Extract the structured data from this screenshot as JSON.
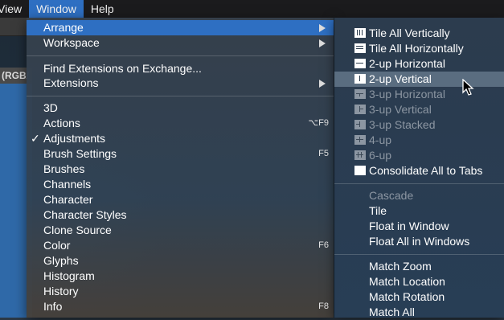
{
  "menubar": {
    "items": [
      {
        "label": "View"
      },
      {
        "label": "Window"
      },
      {
        "label": "Help"
      }
    ]
  },
  "background": {
    "tab_text": "(RGB/"
  },
  "window_menu": {
    "top": [
      {
        "label": "Arrange",
        "submenu": true
      },
      {
        "label": "Workspace",
        "submenu": true
      }
    ],
    "middle": [
      {
        "label": "Find Extensions on Exchange..."
      },
      {
        "label": "Extensions",
        "submenu": true
      }
    ],
    "panels": [
      {
        "label": "3D",
        "shortcut": "",
        "checked": false
      },
      {
        "label": "Actions",
        "shortcut": "⌥F9",
        "checked": false
      },
      {
        "label": "Adjustments",
        "shortcut": "",
        "checked": true
      },
      {
        "label": "Brush Settings",
        "shortcut": "F5",
        "checked": false
      },
      {
        "label": "Brushes",
        "shortcut": "",
        "checked": false
      },
      {
        "label": "Channels",
        "shortcut": "",
        "checked": false
      },
      {
        "label": "Character",
        "shortcut": "",
        "checked": false
      },
      {
        "label": "Character Styles",
        "shortcut": "",
        "checked": false
      },
      {
        "label": "Clone Source",
        "shortcut": "",
        "checked": false
      },
      {
        "label": "Color",
        "shortcut": "F6",
        "checked": false
      },
      {
        "label": "Glyphs",
        "shortcut": "",
        "checked": false
      },
      {
        "label": "Histogram",
        "shortcut": "",
        "checked": false
      },
      {
        "label": "History",
        "shortcut": "",
        "checked": false
      },
      {
        "label": "Info",
        "shortcut": "F8",
        "checked": false
      }
    ],
    "check_mark": "✓"
  },
  "arrange_submenu": {
    "layouts": [
      {
        "label": "Tile All Vertically",
        "icon": "tile-vertical-icon",
        "enabled": true
      },
      {
        "label": "Tile All Horizontally",
        "icon": "tile-horizontal-icon",
        "enabled": true
      },
      {
        "label": "2-up Horizontal",
        "icon": "two-up-horizontal-icon",
        "enabled": true
      },
      {
        "label": "2-up Vertical",
        "icon": "two-up-vertical-icon",
        "enabled": true,
        "highlighted": true
      },
      {
        "label": "3-up Horizontal",
        "icon": "three-up-horizontal-icon",
        "enabled": false
      },
      {
        "label": "3-up Vertical",
        "icon": "three-up-vertical-icon",
        "enabled": false
      },
      {
        "label": "3-up Stacked",
        "icon": "three-up-stacked-icon",
        "enabled": false
      },
      {
        "label": "4-up",
        "icon": "four-up-icon",
        "enabled": false
      },
      {
        "label": "6-up",
        "icon": "six-up-icon",
        "enabled": false
      },
      {
        "label": "Consolidate All to Tabs",
        "icon": "consolidate-tabs-icon",
        "enabled": true
      }
    ],
    "float": [
      {
        "label": "Cascade",
        "enabled": false
      },
      {
        "label": "Tile",
        "enabled": true
      },
      {
        "label": "Float in Window",
        "enabled": true
      },
      {
        "label": "Float All in Windows",
        "enabled": true
      }
    ],
    "match": [
      {
        "label": "Match Zoom",
        "enabled": true
      },
      {
        "label": "Match Location",
        "enabled": true
      },
      {
        "label": "Match Rotation",
        "enabled": true
      },
      {
        "label": "Match All",
        "enabled": true
      }
    ]
  }
}
